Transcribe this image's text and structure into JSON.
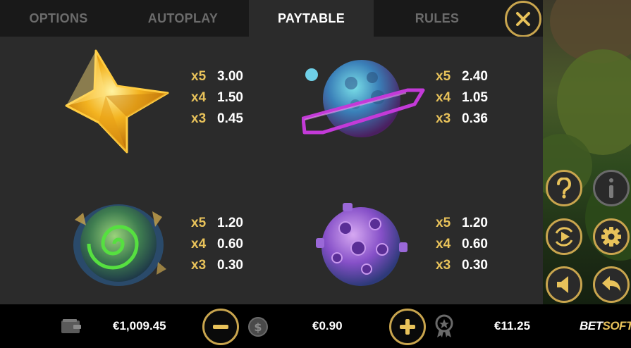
{
  "tabs": [
    {
      "label": "OPTIONS",
      "active": false
    },
    {
      "label": "AUTOPLAY",
      "active": false
    },
    {
      "label": "PAYTABLE",
      "active": true
    },
    {
      "label": "RULES",
      "active": false
    }
  ],
  "paytable": [
    {
      "symbol_icon": "gold-star-icon",
      "payouts": [
        {
          "mult": "x5",
          "value": "3.00"
        },
        {
          "mult": "x4",
          "value": "1.50"
        },
        {
          "mult": "x3",
          "value": "0.45"
        }
      ]
    },
    {
      "symbol_icon": "ringed-planet-icon",
      "payouts": [
        {
          "mult": "x5",
          "value": "2.40"
        },
        {
          "mult": "x4",
          "value": "1.05"
        },
        {
          "mult": "x3",
          "value": "0.36"
        }
      ]
    },
    {
      "symbol_icon": "green-swirl-planet-icon",
      "payouts": [
        {
          "mult": "x5",
          "value": "1.20"
        },
        {
          "mult": "x4",
          "value": "0.60"
        },
        {
          "mult": "x3",
          "value": "0.30"
        }
      ]
    },
    {
      "symbol_icon": "purple-crater-planet-icon",
      "payouts": [
        {
          "mult": "x5",
          "value": "1.20"
        },
        {
          "mult": "x4",
          "value": "0.60"
        },
        {
          "mult": "x3",
          "value": "0.30"
        }
      ]
    }
  ],
  "bottom": {
    "balance": "€1,009.45",
    "bet": "€0.90",
    "win": "€11.25",
    "logo_prefix": "BET",
    "logo_suffix": "SOFT"
  },
  "side_buttons": [
    "help-icon",
    "info-icon",
    "autoplay-icon",
    "settings-icon",
    "sound-icon",
    "back-icon"
  ],
  "colors": {
    "accent": "#c9a54e",
    "multiplier": "#e8c25a",
    "panel": "#2b2b2b",
    "tabbar": "#191919"
  }
}
